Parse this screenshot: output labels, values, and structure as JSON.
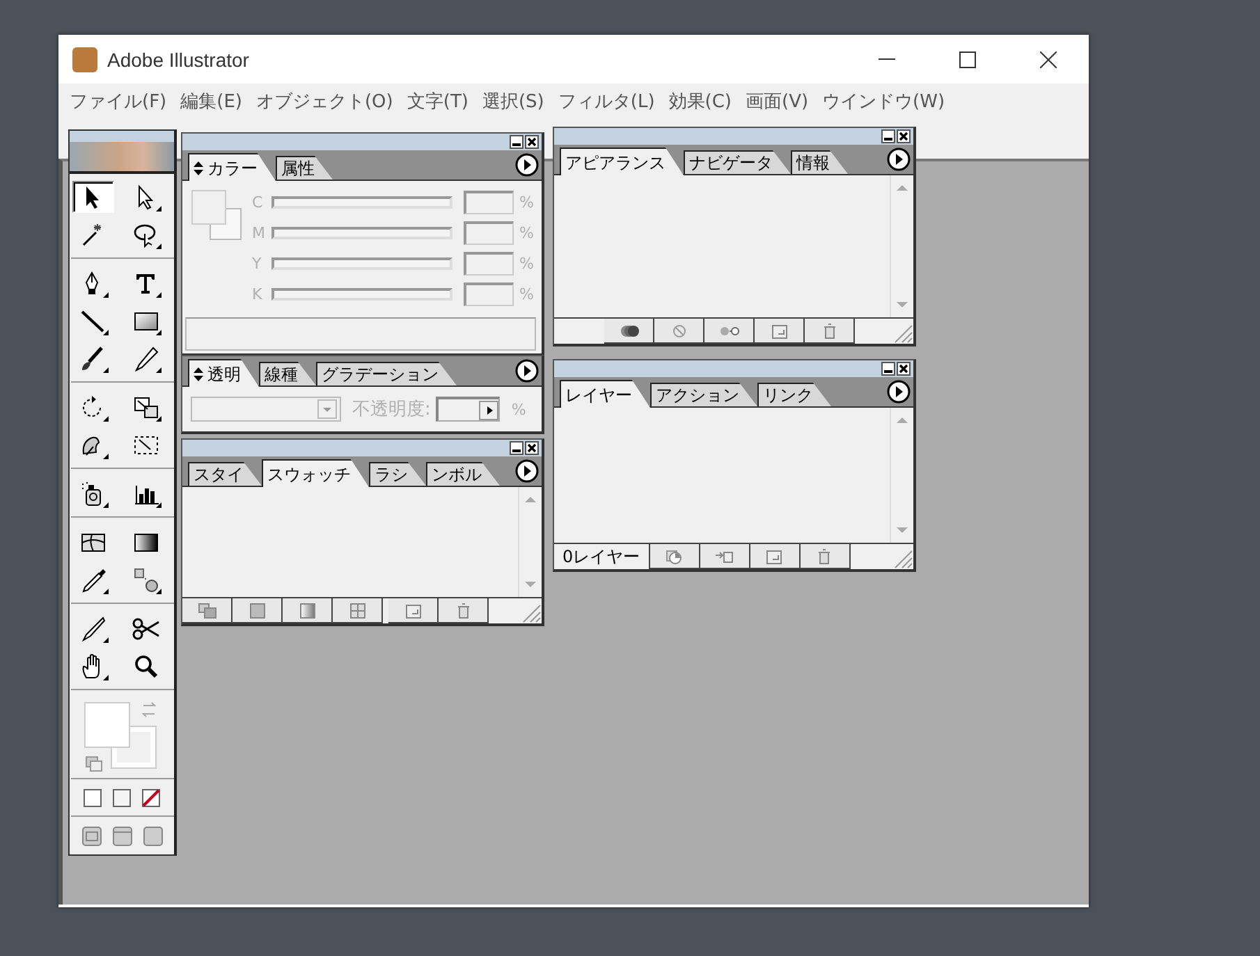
{
  "window": {
    "title": "Adobe Illustrator"
  },
  "menu": [
    "ファイル(F)",
    "編集(E)",
    "オブジェクト(O)",
    "文字(T)",
    "選択(S)",
    "フィルタ(L)",
    "効果(C)",
    "画面(V)",
    "ウインドウ(W)"
  ],
  "toolbox": {
    "tool_groups": [
      {
        "tools": [
          {
            "selected": true
          },
          {
            "selected": false
          },
          {
            "selected": false
          },
          {
            "selected": false
          }
        ]
      },
      {
        "tools": [
          {
            "selected": false
          },
          {
            "selected": false
          },
          {
            "selected": false
          },
          {
            "selected": false
          },
          {
            "selected": false
          },
          {
            "selected": false
          }
        ]
      },
      {
        "tools": [
          {
            "selected": false
          },
          {
            "selected": false
          },
          {
            "selected": false
          },
          {
            "selected": false
          }
        ]
      },
      {
        "tools": [
          {
            "selected": false
          },
          {
            "selected": false
          }
        ]
      },
      {
        "tools": [
          {
            "selected": false
          },
          {
            "selected": false
          },
          {
            "selected": false
          },
          {
            "selected": false
          }
        ]
      },
      {
        "tools": [
          {
            "selected": false
          },
          {
            "selected": false
          },
          {
            "selected": false
          },
          {
            "selected": false
          }
        ]
      }
    ]
  },
  "color_panel": {
    "disabled": true,
    "tabs": [
      {
        "label": "カラー",
        "selected": true,
        "options_toggle": true
      },
      {
        "label": "属性",
        "selected": false,
        "options_toggle": false
      }
    ],
    "channels": [
      {
        "label": "C",
        "unit": "%"
      },
      {
        "label": "M",
        "unit": "%"
      },
      {
        "label": "Y",
        "unit": "%"
      },
      {
        "label": "K",
        "unit": "%"
      }
    ]
  },
  "transparency_panel": {
    "disabled": true,
    "tabs": [
      {
        "label": "透明",
        "selected": true,
        "options_toggle": true
      },
      {
        "label": "線種",
        "selected": false,
        "options_toggle": false
      },
      {
        "label": "グラデーション",
        "selected": false,
        "options_toggle": false
      }
    ],
    "opacity_label": "不透明度:",
    "opacity_unit": "%"
  },
  "swatches_panel": {
    "tabs": [
      {
        "label": "スタイ",
        "selected": false,
        "options_toggle": false
      },
      {
        "label": "スウォッチ",
        "selected": true,
        "options_toggle": false
      },
      {
        "label": "ラシ",
        "selected": false,
        "options_toggle": false
      },
      {
        "label": "ンボル",
        "selected": false,
        "options_toggle": false
      }
    ]
  },
  "appearance_panel": {
    "tabs": [
      {
        "label": "アピアランス",
        "selected": true,
        "options_toggle": false
      },
      {
        "label": "ナビゲータ",
        "selected": false,
        "options_toggle": false
      },
      {
        "label": "情報",
        "selected": false,
        "options_toggle": false
      }
    ]
  },
  "layers_panel": {
    "tabs": [
      {
        "label": "レイヤー",
        "selected": true,
        "options_toggle": false
      },
      {
        "label": "アクション",
        "selected": false,
        "options_toggle": false
      },
      {
        "label": "リンク",
        "selected": false,
        "options_toggle": false
      }
    ],
    "layer_count": "0レイヤー"
  }
}
